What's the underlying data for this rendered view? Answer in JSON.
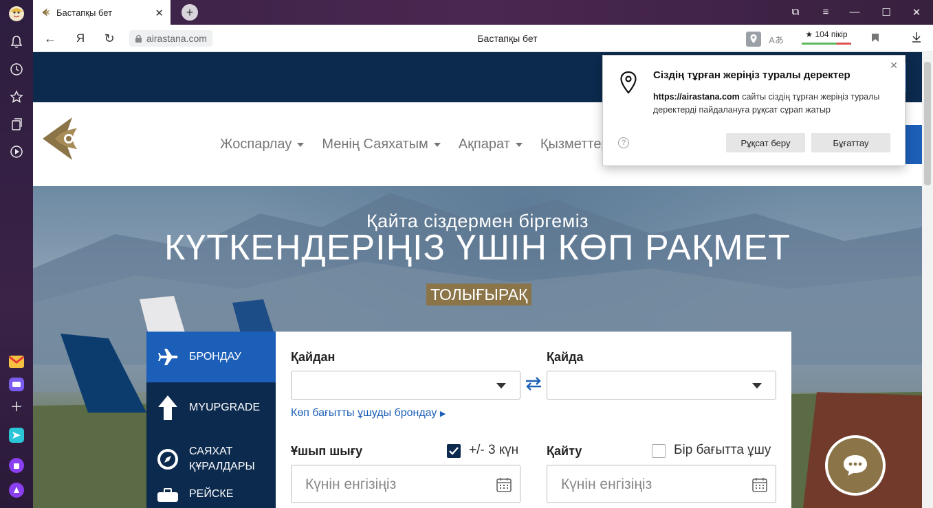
{
  "browser": {
    "tab_title": "Бастапқы бет",
    "url": "airastana.com",
    "page_title": "Бастапқы бет",
    "reviews": "★ 104 пікір",
    "icons": [
      "alice-icon",
      "bell-icon",
      "history-icon",
      "star-icon",
      "collections-icon",
      "video-icon",
      "mail-icon",
      "messenger-icon",
      "add-icon"
    ]
  },
  "header": {
    "menu": [
      "Жоспарлау",
      "Менің Саяхатым",
      "Ақпарат",
      "Қызметтер"
    ]
  },
  "hero": {
    "subtitle": "Қайта сіздермен біргеміз",
    "title": "КҮТКЕНДЕРІҢІЗ ҮШІН КӨП РАҚМЕТ",
    "button": "ТОЛЫҒЫРАҚ"
  },
  "booking": {
    "tabs": [
      {
        "label": "БРОНДАУ"
      },
      {
        "label": "MYUPGRADE"
      },
      {
        "label": "САЯХАТ ҚҰРАЛДАРЫ"
      },
      {
        "label": "РЕЙСКЕ"
      }
    ],
    "from_label": "Қайдан",
    "to_label": "Қайда",
    "multi_link": "Көп бағытты ұшуды брондау",
    "depart_label": "Ұшып шығу",
    "flex_label": "+/- 3 күн",
    "flex_checked": true,
    "return_label": "Қайту",
    "oneway_label": "Бір бағытта ұшу",
    "oneway_checked": false,
    "date_placeholder": "Күнін енгізіңіз"
  },
  "permission": {
    "title": "Сіздің тұрған жеріңіз туралы деректер",
    "site": "https://airastana.com",
    "text": "сайты сіздің тұрған жеріңіз туралы деректерді пайдалануға рұқсат сұрап жатыр",
    "allow": "Рұқсат беру",
    "block": "Бұғаттау"
  },
  "colors": {
    "navy": "#0c2a4e",
    "blue": "#1c5fb8",
    "gold": "#8b7448"
  }
}
